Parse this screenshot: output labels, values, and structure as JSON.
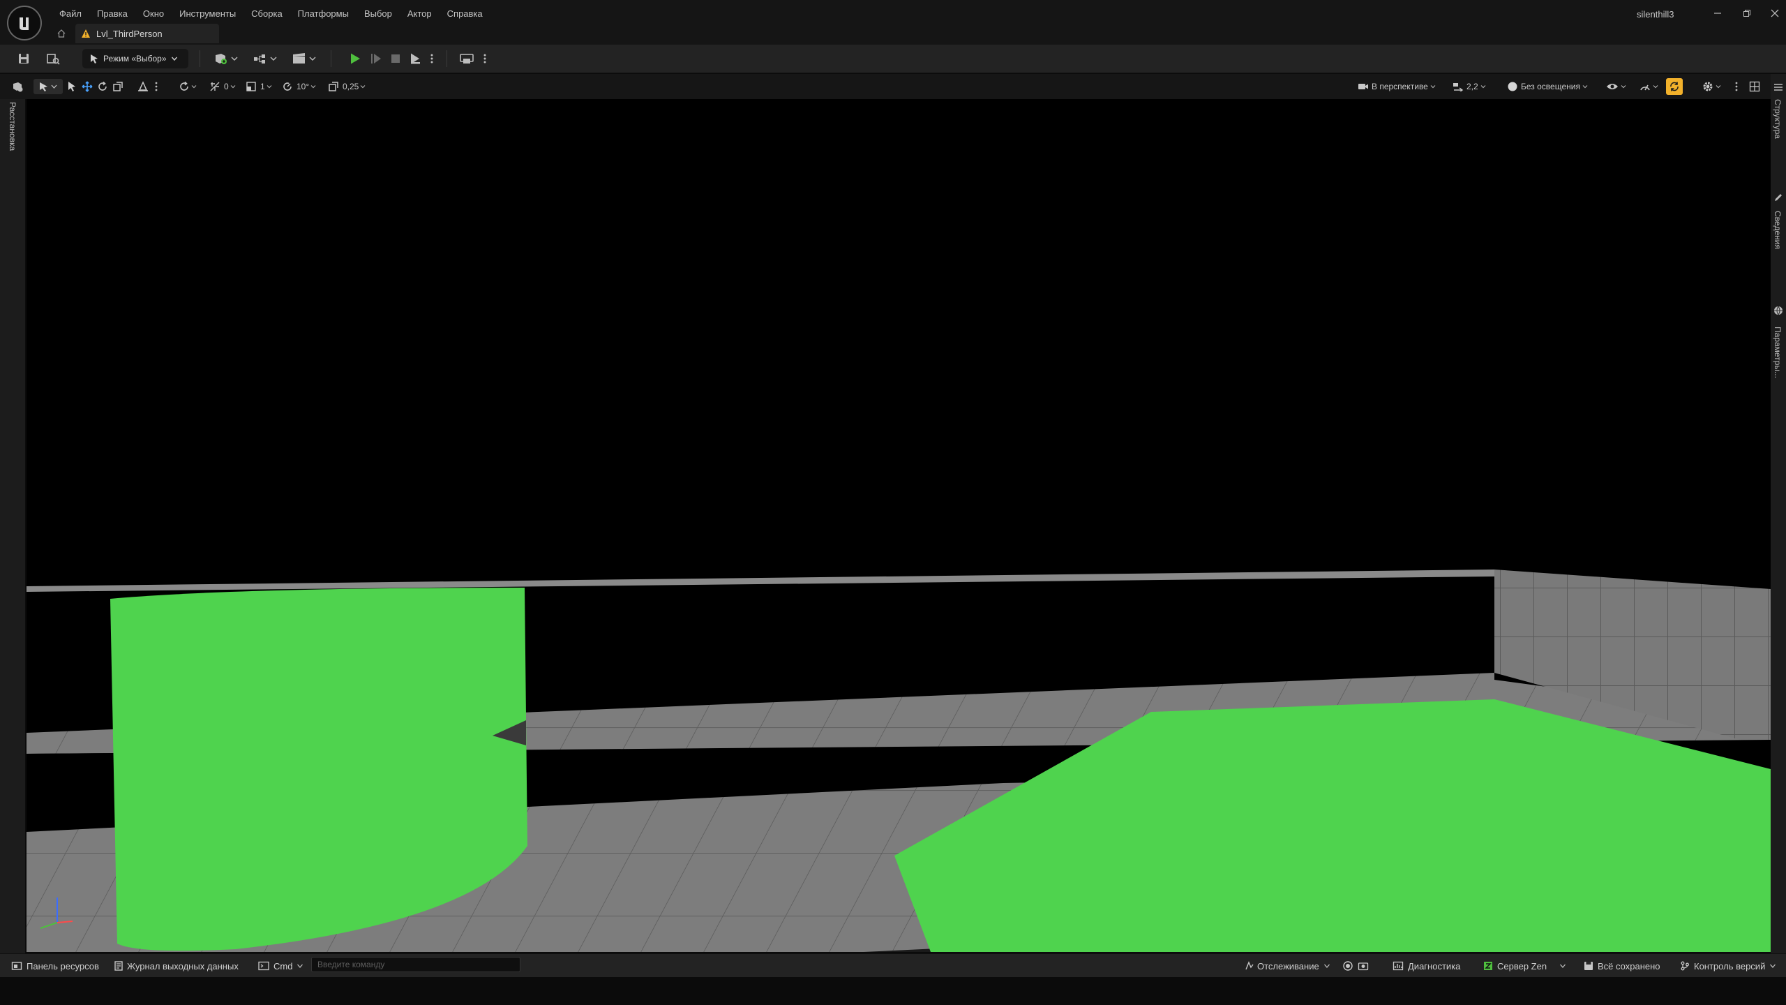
{
  "menu": {
    "items": [
      "Файл",
      "Правка",
      "Окно",
      "Инструменты",
      "Сборка",
      "Платформы",
      "Выбор",
      "Актор",
      "Справка"
    ]
  },
  "user": {
    "name": "silenthill3"
  },
  "level_tab": {
    "label": "Lvl_ThirdPerson"
  },
  "toolbar": {
    "mode_label": "Режим «Выбор»"
  },
  "viewport_toolbar": {
    "rotation_snap_value": "0",
    "translate_snap_value": "1",
    "angle_snap_value": "10°",
    "scale_snap_value": "0,25",
    "view_mode_label": "В перспективе",
    "camera_speed": "2,2",
    "lighting_label": "Без освещения"
  },
  "left_rail": {
    "place_actors_label": "Расстановка"
  },
  "right_rail": {
    "outliner_label": "Структура",
    "details_label": "Сведения",
    "settings_label": "Параметры..."
  },
  "statusbar": {
    "content_drawer": "Панель ресурсов",
    "output_log": "Журнал выходных данных",
    "cmd_label": "Cmd",
    "cmd_placeholder": "Введите команду",
    "tracking": "Отслеживание",
    "diagnostics": "Диагностика",
    "zen_server": "Сервер Zen",
    "all_saved": "Всё сохранено",
    "source_control": "Контроль версий"
  },
  "colors": {
    "accent_green": "#4fd34e",
    "play_green": "#4fbf3e",
    "highlight_yellow": "#f2b12b",
    "grid_gray": "#7f7f7f",
    "viewport_bg": "#000000"
  }
}
